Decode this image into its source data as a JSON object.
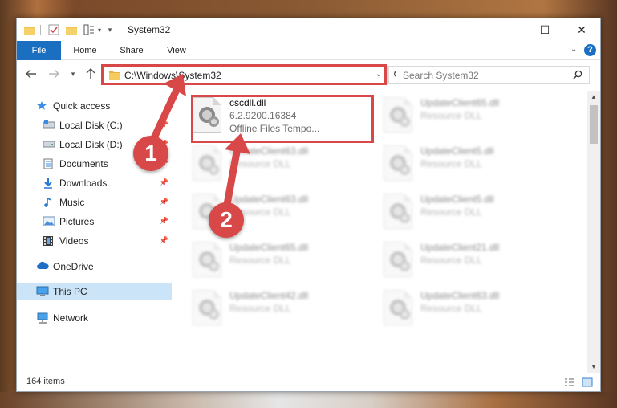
{
  "window": {
    "title": "System32",
    "controls": {
      "minimize": "—",
      "maximize": "☐",
      "close": "✕"
    }
  },
  "ribbon": {
    "tabs": [
      "File",
      "Home",
      "Share",
      "View"
    ],
    "help": "?"
  },
  "address": {
    "path": "C:\\Windows\\System32",
    "search_placeholder": "Search System32"
  },
  "nav": {
    "items": [
      {
        "label": "Quick access",
        "icon": "star-icon",
        "pinned": false
      },
      {
        "label": "Local Disk (C:)",
        "icon": "drive-icon",
        "pinned": true
      },
      {
        "label": "Local Disk (D:)",
        "icon": "drive-icon",
        "pinned": true
      },
      {
        "label": "Documents",
        "icon": "documents-icon",
        "pinned": true
      },
      {
        "label": "Downloads",
        "icon": "download-icon",
        "pinned": true
      },
      {
        "label": "Music",
        "icon": "music-icon",
        "pinned": true
      },
      {
        "label": "Pictures",
        "icon": "pictures-icon",
        "pinned": true
      },
      {
        "label": "Videos",
        "icon": "videos-icon",
        "pinned": true
      },
      {
        "label": "OneDrive",
        "icon": "cloud-icon",
        "pinned": false
      },
      {
        "label": "This PC",
        "icon": "computer-icon",
        "pinned": false,
        "selected": true
      },
      {
        "label": "Network",
        "icon": "network-icon",
        "pinned": false
      }
    ]
  },
  "files": {
    "highlighted": {
      "name": "cscdll.dll",
      "version": "6.2.9200.16384",
      "description": "Offline Files Tempo..."
    },
    "left_column": [
      {
        "name": "UpdateClient63.dll",
        "type": "Resource DLL"
      },
      {
        "name": "UpdateClient63.dll",
        "type": "Resource DLL"
      },
      {
        "name": "UpdateClient65.dll",
        "type": "Resource DLL"
      },
      {
        "name": "UpdateClient42.dll",
        "type": "Resource DLL"
      }
    ],
    "right_column": [
      {
        "name": "UpdateClient65.dll",
        "type": "Resource DLL"
      },
      {
        "name": "UpdateClient5.dll",
        "type": "Resource DLL"
      },
      {
        "name": "UpdateClient5.dll",
        "type": "Resource DLL"
      },
      {
        "name": "UpdateClient21.dll",
        "type": "Resource DLL"
      },
      {
        "name": "UpdateClient63.dll",
        "type": "Resource DLL"
      }
    ]
  },
  "status": {
    "count": "164 items"
  },
  "callouts": [
    "1",
    "2"
  ],
  "colors": {
    "accent": "#1a6fc0",
    "annotation": "#d94848",
    "selection": "#cce4f7"
  }
}
